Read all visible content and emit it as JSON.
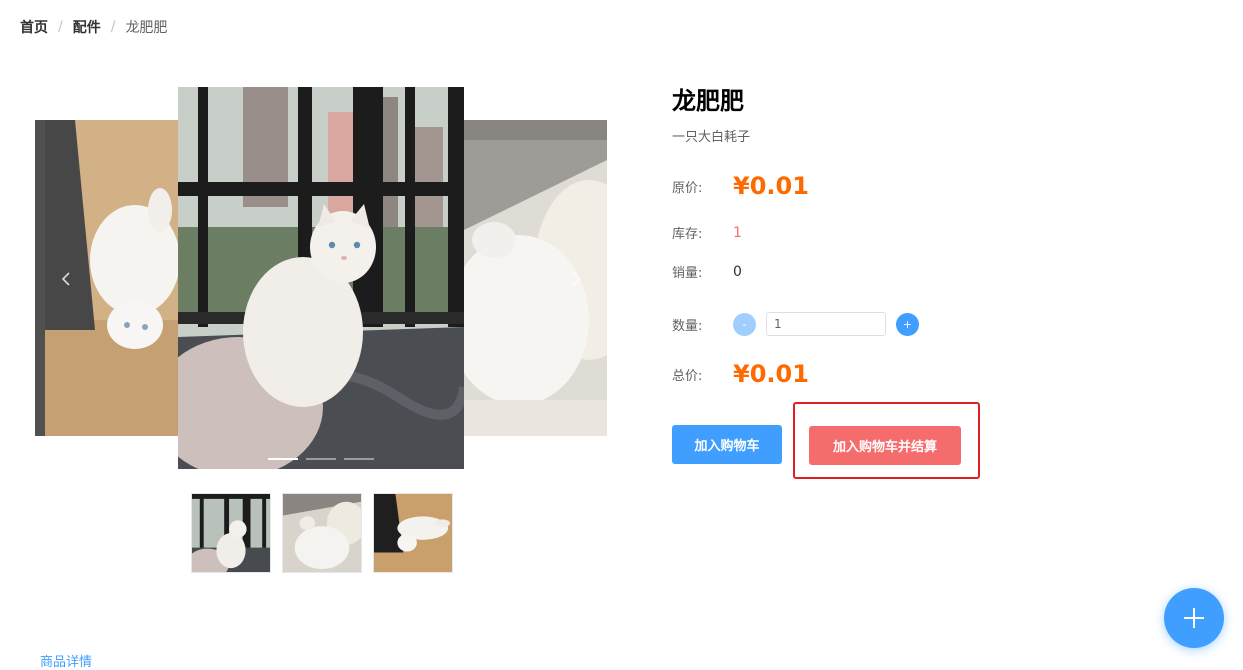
{
  "breadcrumb": {
    "home": "首页",
    "separator": "/",
    "category": "配件",
    "current": "龙肥肥"
  },
  "carousel": {
    "total_slides": 3,
    "active_index": 0
  },
  "product": {
    "name": "龙肥肥",
    "description": "一只大白耗子",
    "original_price_label": "原价:",
    "original_price": "¥0.01",
    "stock_label": "库存:",
    "stock": "1",
    "sales_label": "销量:",
    "sales": "0",
    "quantity_label": "数量:",
    "quantity": "1",
    "minus_label": "-",
    "plus_label": "+",
    "total_label": "总价:",
    "total_price": "¥0.01"
  },
  "actions": {
    "add_to_cart": "加入购物车",
    "add_and_checkout": "加入购物车并结算"
  },
  "tabs": {
    "details": "商品详情"
  },
  "colors": {
    "primary": "#409eff",
    "price": "#ff6a00",
    "danger": "#f56c6c",
    "highlight": "#e02020"
  },
  "icons": {
    "prev": "chevron-left-icon",
    "next": "chevron-right-icon",
    "fab": "plus-icon"
  }
}
